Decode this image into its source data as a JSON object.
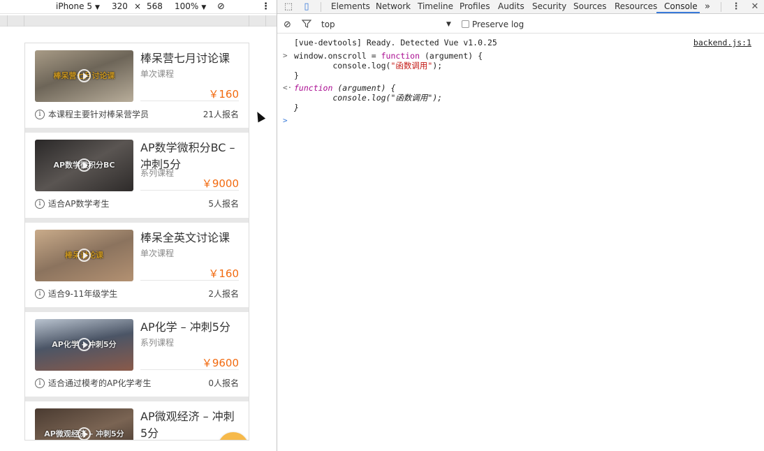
{
  "device_toolbar": {
    "device": "iPhone 5",
    "width": "320",
    "times": "×",
    "height": "568",
    "zoom": "100%",
    "rotate_icon": "rotate-icon",
    "menu_icon": "more-vertical-icon"
  },
  "courses": [
    {
      "thumb_text": "棒呆营七月讨论课",
      "thumb_bg": "#7c7263",
      "title": "棒呆营七月讨论课",
      "type": "单次课程",
      "price": "￥160",
      "info": "本课程主要针对棒呆营学员",
      "enrolled": "21人报名"
    },
    {
      "thumb_text": "AP数学微积分BC",
      "thumb_bg": "#3b3838",
      "title": "AP数学微积分BC – 冲刺5分",
      "type": "系列课程",
      "price": "￥9000",
      "info": "适合AP数学考生",
      "enrolled": "5人报名"
    },
    {
      "thumb_text": "棒呆讨论课",
      "thumb_bg": "#a58a72",
      "title": "棒呆全英文讨论课",
      "type": "单次课程",
      "price": "￥160",
      "info": "适合9-11年级学生",
      "enrolled": "2人报名"
    },
    {
      "thumb_text": "AP化学 – 冲刺5分",
      "thumb_bg": "#5f6674",
      "title": "AP化学 – 冲刺5分",
      "type": "系列课程",
      "price": "￥9600",
      "info": "适合通过模考的AP化学考生",
      "enrolled": "0人报名"
    },
    {
      "thumb_text": "AP微观经济 – 冲刺5分",
      "thumb_bg": "#55453a",
      "title": "AP微观经济 – 冲刺 5分",
      "type": "",
      "price": "",
      "info": "",
      "enrolled": ""
    }
  ],
  "devtools": {
    "tabs": [
      "Elements",
      "Network",
      "Timeline",
      "Profiles",
      "Audits",
      "Security",
      "Sources",
      "Resources",
      "Console"
    ],
    "active_tab": "Console",
    "more_tabs": "»",
    "filter": {
      "context": "top",
      "preserve_log": "Preserve log"
    },
    "console": {
      "lines": [
        "[vue-devtools] Ready. Detected Vue v1.0.25",
        "window.onscroll = ",
        "function",
        " (argument) {",
        "        console.log(",
        "\"函数调用\"",
        ");",
        "}",
        "function",
        " (argument) {",
        "        console.log(\"函数调用\");",
        "}"
      ],
      "source_link": "backend.js:1"
    },
    "accent_color": "#3879d9"
  }
}
